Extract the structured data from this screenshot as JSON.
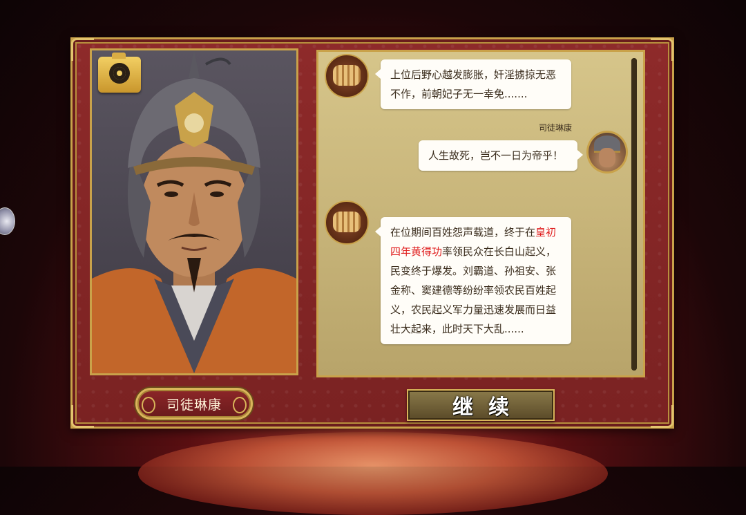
{
  "character": {
    "name": "司徒琳康"
  },
  "dialog": {
    "messages": [
      {
        "side": "left",
        "speaker_icon": "scroll-icon",
        "text": "上位后野心越发膨胀，奸淫掳掠无恶不作，前朝妃子无一幸免......."
      },
      {
        "side": "right",
        "speaker": "司徒琳康",
        "speaker_icon": "general-avatar",
        "text": "人生故死，岂不一日为帝乎！"
      },
      {
        "side": "left",
        "speaker_icon": "scroll-icon",
        "text_before": "在位期间百姓怨声载道，终于在",
        "text_highlight": "皇初四年黄得功",
        "text_after": "率领民众在长白山起义，民变终于爆发。刘霸道、孙祖安、张金称、窦建德等纷纷率领农民百姓起义，农民起义军力量迅速发展而日益壮大起来，此时天下大乱......"
      }
    ]
  },
  "buttons": {
    "continue_label": "继续"
  },
  "icons": {
    "camera": "camera-icon"
  },
  "colors": {
    "highlight": "#e02020",
    "frame_red": "#8e2a2a",
    "gold_border": "#c9a24a",
    "panel_bg": "#d6c58a"
  }
}
